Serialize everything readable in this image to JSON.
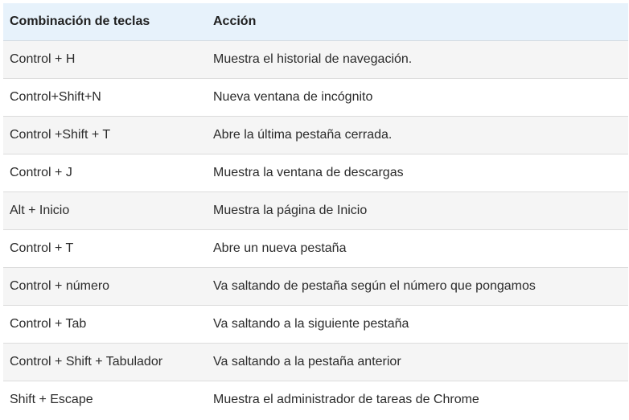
{
  "table": {
    "headers": {
      "keys": "Combinación de teclas",
      "action": "Acción"
    },
    "rows": [
      {
        "keys": "Control + H",
        "action": "Muestra el historial de navegación."
      },
      {
        "keys": "Control+Shift+N",
        "action": "Nueva ventana de incógnito"
      },
      {
        "keys": "Control +Shift + T",
        "action": "Abre la última pestaña cerrada."
      },
      {
        "keys": "Control + J",
        "action": "Muestra la ventana de descargas"
      },
      {
        "keys": "Alt + Inicio",
        "action": "Muestra la página de Inicio"
      },
      {
        "keys": "Control + T",
        "action": "Abre un nueva pestaña"
      },
      {
        "keys": "Control + número",
        "action": "Va saltando de pestaña según el número que pongamos"
      },
      {
        "keys": "Control + Tab",
        "action": "Va saltando a la siguiente pestaña"
      },
      {
        "keys": "Control + Shift + Tabulador",
        "action": "Va saltando a la pestaña anterior"
      },
      {
        "keys": "Shift + Escape",
        "action": "Muestra el administrador de tareas de Chrome"
      }
    ]
  }
}
